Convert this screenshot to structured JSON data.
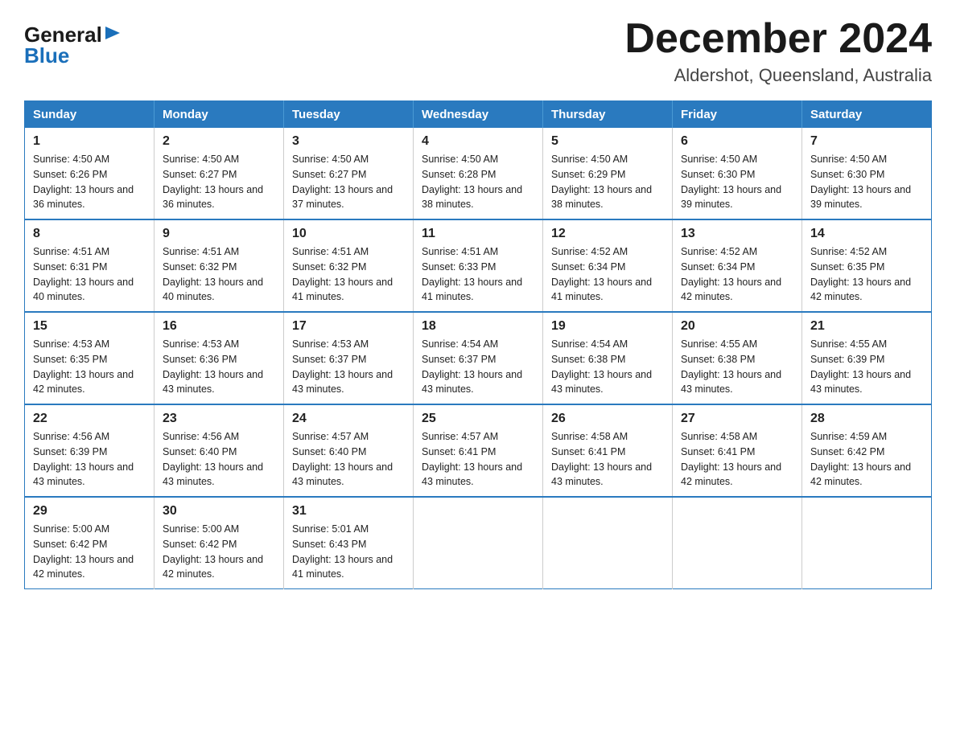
{
  "logo": {
    "general": "General",
    "triangle": "▶",
    "blue": "Blue"
  },
  "title": "December 2024",
  "location": "Aldershot, Queensland, Australia",
  "days_of_week": [
    "Sunday",
    "Monday",
    "Tuesday",
    "Wednesday",
    "Thursday",
    "Friday",
    "Saturday"
  ],
  "weeks": [
    [
      {
        "day": "1",
        "sunrise": "4:50 AM",
        "sunset": "6:26 PM",
        "daylight": "13 hours and 36 minutes."
      },
      {
        "day": "2",
        "sunrise": "4:50 AM",
        "sunset": "6:27 PM",
        "daylight": "13 hours and 36 minutes."
      },
      {
        "day": "3",
        "sunrise": "4:50 AM",
        "sunset": "6:27 PM",
        "daylight": "13 hours and 37 minutes."
      },
      {
        "day": "4",
        "sunrise": "4:50 AM",
        "sunset": "6:28 PM",
        "daylight": "13 hours and 38 minutes."
      },
      {
        "day": "5",
        "sunrise": "4:50 AM",
        "sunset": "6:29 PM",
        "daylight": "13 hours and 38 minutes."
      },
      {
        "day": "6",
        "sunrise": "4:50 AM",
        "sunset": "6:30 PM",
        "daylight": "13 hours and 39 minutes."
      },
      {
        "day": "7",
        "sunrise": "4:50 AM",
        "sunset": "6:30 PM",
        "daylight": "13 hours and 39 minutes."
      }
    ],
    [
      {
        "day": "8",
        "sunrise": "4:51 AM",
        "sunset": "6:31 PM",
        "daylight": "13 hours and 40 minutes."
      },
      {
        "day": "9",
        "sunrise": "4:51 AM",
        "sunset": "6:32 PM",
        "daylight": "13 hours and 40 minutes."
      },
      {
        "day": "10",
        "sunrise": "4:51 AM",
        "sunset": "6:32 PM",
        "daylight": "13 hours and 41 minutes."
      },
      {
        "day": "11",
        "sunrise": "4:51 AM",
        "sunset": "6:33 PM",
        "daylight": "13 hours and 41 minutes."
      },
      {
        "day": "12",
        "sunrise": "4:52 AM",
        "sunset": "6:34 PM",
        "daylight": "13 hours and 41 minutes."
      },
      {
        "day": "13",
        "sunrise": "4:52 AM",
        "sunset": "6:34 PM",
        "daylight": "13 hours and 42 minutes."
      },
      {
        "day": "14",
        "sunrise": "4:52 AM",
        "sunset": "6:35 PM",
        "daylight": "13 hours and 42 minutes."
      }
    ],
    [
      {
        "day": "15",
        "sunrise": "4:53 AM",
        "sunset": "6:35 PM",
        "daylight": "13 hours and 42 minutes."
      },
      {
        "day": "16",
        "sunrise": "4:53 AM",
        "sunset": "6:36 PM",
        "daylight": "13 hours and 43 minutes."
      },
      {
        "day": "17",
        "sunrise": "4:53 AM",
        "sunset": "6:37 PM",
        "daylight": "13 hours and 43 minutes."
      },
      {
        "day": "18",
        "sunrise": "4:54 AM",
        "sunset": "6:37 PM",
        "daylight": "13 hours and 43 minutes."
      },
      {
        "day": "19",
        "sunrise": "4:54 AM",
        "sunset": "6:38 PM",
        "daylight": "13 hours and 43 minutes."
      },
      {
        "day": "20",
        "sunrise": "4:55 AM",
        "sunset": "6:38 PM",
        "daylight": "13 hours and 43 minutes."
      },
      {
        "day": "21",
        "sunrise": "4:55 AM",
        "sunset": "6:39 PM",
        "daylight": "13 hours and 43 minutes."
      }
    ],
    [
      {
        "day": "22",
        "sunrise": "4:56 AM",
        "sunset": "6:39 PM",
        "daylight": "13 hours and 43 minutes."
      },
      {
        "day": "23",
        "sunrise": "4:56 AM",
        "sunset": "6:40 PM",
        "daylight": "13 hours and 43 minutes."
      },
      {
        "day": "24",
        "sunrise": "4:57 AM",
        "sunset": "6:40 PM",
        "daylight": "13 hours and 43 minutes."
      },
      {
        "day": "25",
        "sunrise": "4:57 AM",
        "sunset": "6:41 PM",
        "daylight": "13 hours and 43 minutes."
      },
      {
        "day": "26",
        "sunrise": "4:58 AM",
        "sunset": "6:41 PM",
        "daylight": "13 hours and 43 minutes."
      },
      {
        "day": "27",
        "sunrise": "4:58 AM",
        "sunset": "6:41 PM",
        "daylight": "13 hours and 42 minutes."
      },
      {
        "day": "28",
        "sunrise": "4:59 AM",
        "sunset": "6:42 PM",
        "daylight": "13 hours and 42 minutes."
      }
    ],
    [
      {
        "day": "29",
        "sunrise": "5:00 AM",
        "sunset": "6:42 PM",
        "daylight": "13 hours and 42 minutes."
      },
      {
        "day": "30",
        "sunrise": "5:00 AM",
        "sunset": "6:42 PM",
        "daylight": "13 hours and 42 minutes."
      },
      {
        "day": "31",
        "sunrise": "5:01 AM",
        "sunset": "6:43 PM",
        "daylight": "13 hours and 41 minutes."
      },
      null,
      null,
      null,
      null
    ]
  ],
  "labels": {
    "sunrise_prefix": "Sunrise: ",
    "sunset_prefix": "Sunset: ",
    "daylight_prefix": "Daylight: "
  }
}
